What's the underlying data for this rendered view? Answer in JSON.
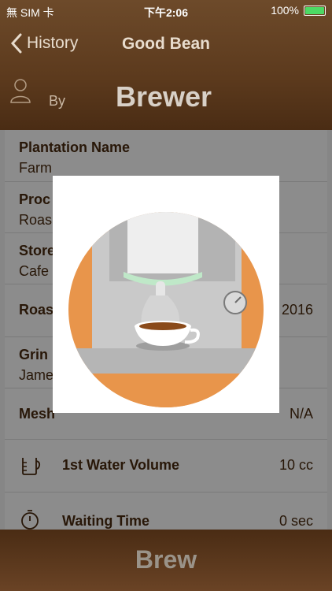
{
  "status": {
    "carrier": "無 SIM 卡",
    "time": "下午2:06",
    "battery": "100%"
  },
  "nav": {
    "back_label": "History",
    "title": "Good Bean"
  },
  "header": {
    "by_label": "By",
    "brewer_label": "Brewer"
  },
  "rows": {
    "plantation": {
      "title": "Plantation Name",
      "value": "Farm"
    },
    "process": {
      "title": "Proc",
      "value": "Roas"
    },
    "store": {
      "title": "Store",
      "value": "Cafe"
    },
    "roast": {
      "title": "Roas",
      "value": "2016"
    },
    "grind": {
      "title": "Grin",
      "value": "Jame"
    },
    "mesh": {
      "title": "Mesh",
      "value": "N/A"
    },
    "water": {
      "title": "1st Water Volume",
      "value": "10 cc",
      "icon": "measuring-cup-icon"
    },
    "waiting": {
      "title": "Waiting Time",
      "value": "0 sec",
      "icon": "timer-icon"
    }
  },
  "footer": {
    "brew_label": "Brew"
  },
  "colors": {
    "accent_brown": "#5c3a1d",
    "orange": "#e8954b",
    "mint": "#bfe8c8"
  }
}
